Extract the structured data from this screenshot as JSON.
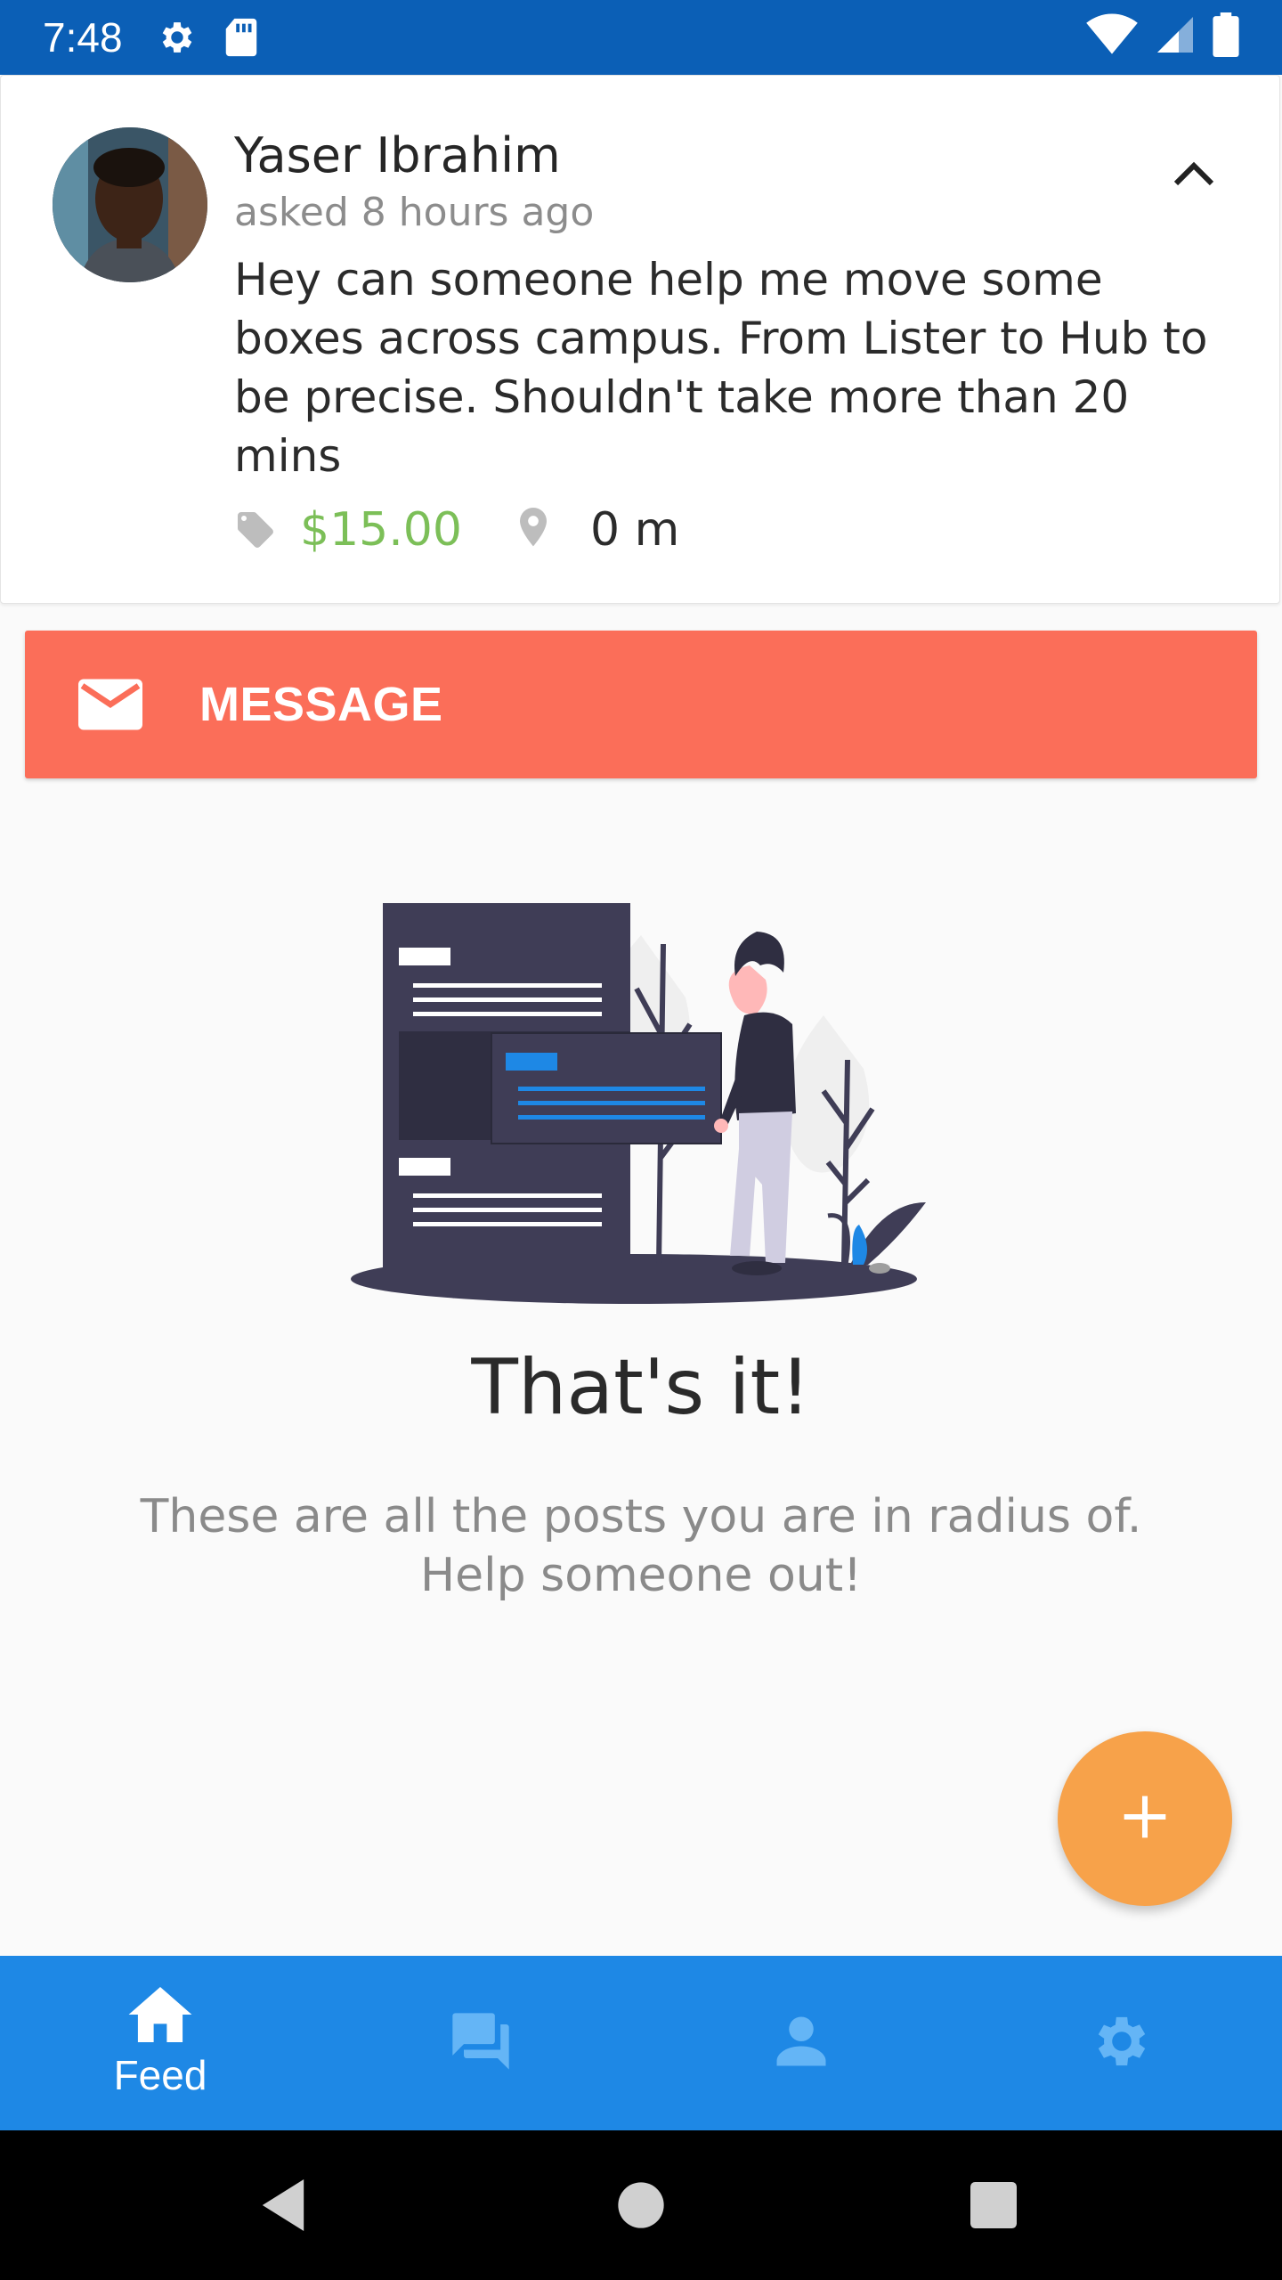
{
  "status_bar": {
    "time": "7:48",
    "icons": [
      "gear-icon",
      "sd-card-icon",
      "wifi-icon",
      "signal-icon",
      "battery-icon"
    ]
  },
  "post": {
    "author": "Yaser Ibrahim",
    "time": "asked 8 hours ago",
    "body": "Hey can someone help me move some boxes across campus. From Lister to Hub to be precise. Shouldn't take more than 20 mins",
    "price": "$15.00",
    "distance": "0 m",
    "price_color": "#7cbf58"
  },
  "message_button": {
    "label": "MESSAGE",
    "color": "#fb6e59"
  },
  "empty_state": {
    "title": "That's it!",
    "subtitle": "These are all the posts you are in radius of. Help someone out!"
  },
  "fab": {
    "icon": "plus-icon",
    "color": "#f7a24a"
  },
  "bottom_nav": {
    "color": "#1e88e5",
    "items": [
      {
        "icon": "home-icon",
        "label": "Feed",
        "active": true
      },
      {
        "icon": "chat-icon",
        "label": "",
        "active": false
      },
      {
        "icon": "person-icon",
        "label": "",
        "active": false
      },
      {
        "icon": "settings-icon",
        "label": "",
        "active": false
      }
    ]
  },
  "system_nav": {
    "icons": [
      "back-icon",
      "home-circle-icon",
      "recents-icon"
    ]
  }
}
